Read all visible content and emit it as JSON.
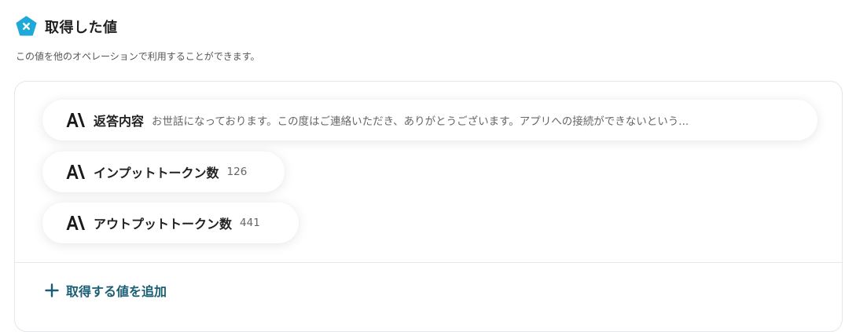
{
  "header": {
    "icon": "pentagon-x-icon",
    "title": "取得した値",
    "description": "この値を他のオペレーションで利用することができます。"
  },
  "values": [
    {
      "icon": "anthropic-logo-icon",
      "label": "返答内容",
      "value": "お世話になっております。この度はご連絡いただき、ありがとうございます。アプリへの接続ができないという..."
    },
    {
      "icon": "anthropic-logo-icon",
      "label": "インプットトークン数",
      "value": "126"
    },
    {
      "icon": "anthropic-logo-icon",
      "label": "アウトプットトークン数",
      "value": "441"
    }
  ],
  "add_button": {
    "label": "取得する値を追加",
    "icon": "plus-icon"
  },
  "colors": {
    "accent": "#1a5e73",
    "icon_bg": "#1fa9d8"
  }
}
